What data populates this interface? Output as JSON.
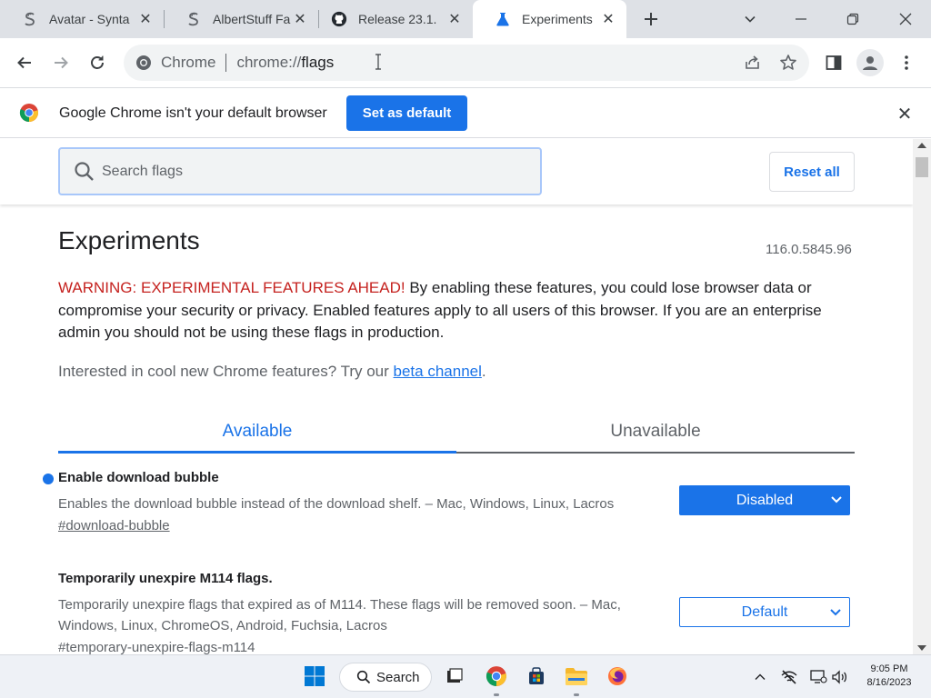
{
  "tabs": [
    {
      "title": "Avatar - Synta",
      "icon": "syntax-s-icon"
    },
    {
      "title": "AlbertStuff Fa",
      "icon": "syntax-s-icon"
    },
    {
      "title": "Release 23.1.",
      "icon": "github-icon"
    },
    {
      "title": "Experiments",
      "icon": "flask-icon",
      "active": true
    }
  ],
  "toolbar": {
    "site_name": "Chrome",
    "url_scheme": "chrome://",
    "url_path": "flags"
  },
  "infobar": {
    "message": "Google Chrome isn't your default browser",
    "button": "Set as default"
  },
  "search": {
    "placeholder": "Search flags",
    "reset_label": "Reset all"
  },
  "page": {
    "title": "Experiments",
    "version": "116.0.5845.96",
    "warning_label": "WARNING: EXPERIMENTAL FEATURES AHEAD!",
    "warning_text": " By enabling these features, you could lose browser data or compromise your security or privacy. Enabled features apply to all users of this browser. If you are an enterprise admin you should not be using these flags in production.",
    "interested_text": "Interested in cool new Chrome features? Try our ",
    "beta_link": "beta channel",
    "interested_end": "."
  },
  "content_tabs": {
    "available": "Available",
    "unavailable": "Unavailable"
  },
  "flags": [
    {
      "name": "Enable download bubble",
      "description": "Enables the download bubble instead of the download shelf. – Mac, Windows, Linux, Lacros",
      "anchor": "#download-bubble",
      "value": "Disabled",
      "modified": true
    },
    {
      "name": "Temporarily unexpire M114 flags.",
      "description": "Temporarily unexpire flags that expired as of M114. These flags will be removed soon. – Mac, Windows, Linux, ChromeOS, Android, Fuchsia, Lacros",
      "anchor": "#temporary-unexpire-flags-m114",
      "value": "Default",
      "modified": false
    }
  ],
  "taskbar": {
    "search_label": "Search",
    "time": "9:05 PM",
    "date": "8/16/2023"
  },
  "colors": {
    "accent": "#1a73e8",
    "warning": "#c5221f"
  }
}
